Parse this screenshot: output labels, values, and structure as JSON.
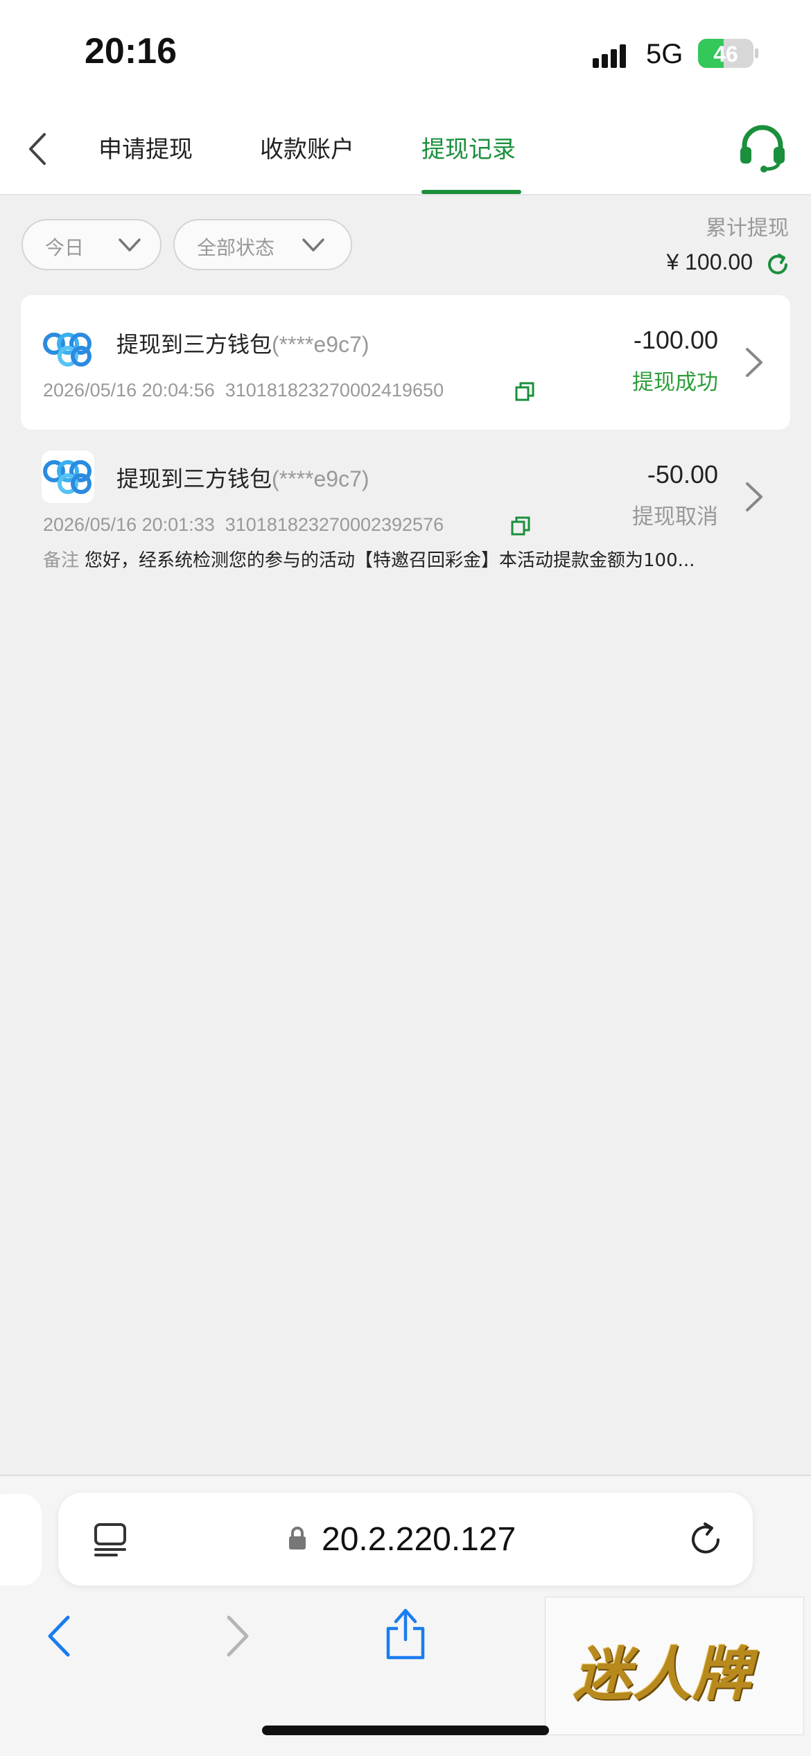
{
  "status_bar": {
    "time": "20:16",
    "network": "5G",
    "battery_level": "46"
  },
  "nav": {
    "tabs": [
      {
        "label": "申请提现",
        "active": false
      },
      {
        "label": "收款账户",
        "active": false
      },
      {
        "label": "提现记录",
        "active": true
      }
    ],
    "icons": {
      "back": "chevron-left-icon",
      "support": "headset-icon"
    }
  },
  "filters": {
    "date": "今日",
    "status": "全部状态"
  },
  "summary": {
    "label": "累计提现",
    "total": "¥ 100.00"
  },
  "records": [
    {
      "title": "提现到三方钱包",
      "masked_account": "(****e9c7)",
      "datetime": "2026/05/16 20:04:56",
      "order_no": "310181823270002419650",
      "amount": "-100.00",
      "status": "提现成功",
      "status_color": "#2e9e3a"
    },
    {
      "title": "提现到三方钱包",
      "masked_account": "(****e9c7)",
      "datetime": "2026/05/16 20:01:33",
      "order_no": "310181823270002392576",
      "amount": "-50.00",
      "status": "提现取消",
      "status_color": "#999999",
      "remark_label": "备注",
      "remark": "您好，经系统检测您的参与的活动【特邀召回彩金】本活动提款金额为100..."
    }
  ],
  "browser": {
    "url": "20.2.220.127"
  },
  "watermark": "迷人牌",
  "colors": {
    "accent": "#1a8f3c",
    "success": "#2e9e3a",
    "muted": "#999999"
  }
}
